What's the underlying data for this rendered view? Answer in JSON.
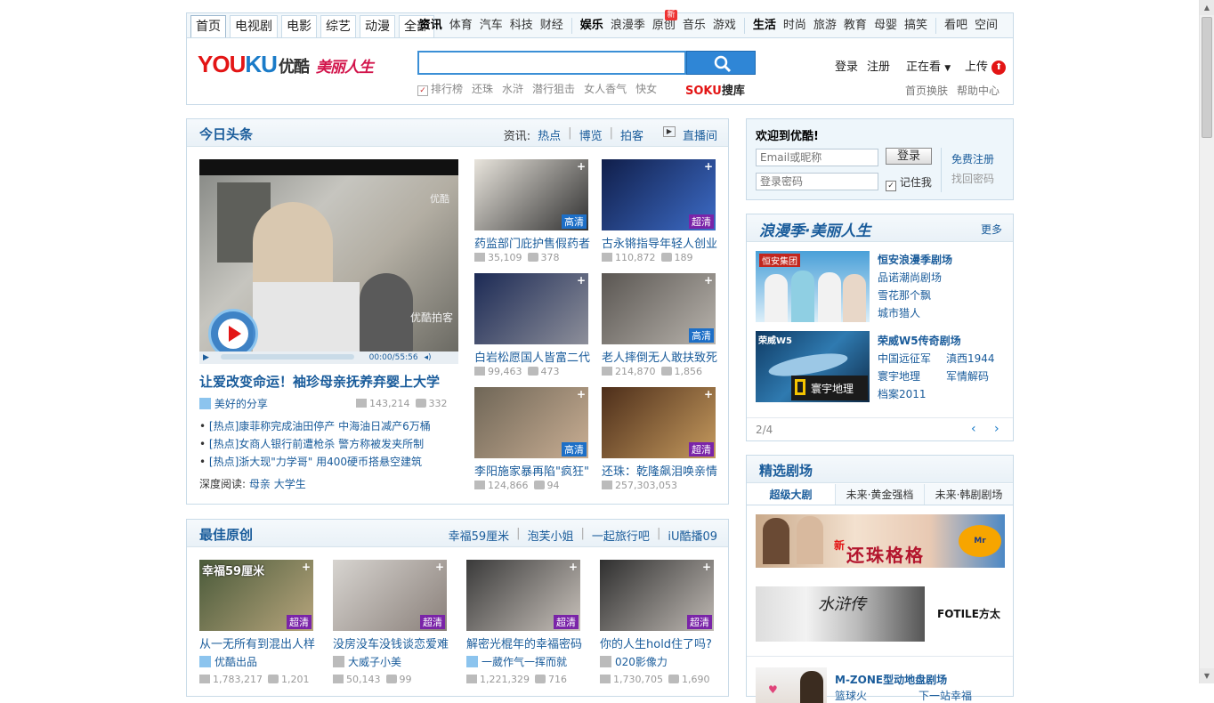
{
  "nav": {
    "tabs": [
      "首页",
      "电视剧",
      "电影",
      "综艺",
      "动漫",
      "全部"
    ],
    "groups": [
      {
        "head": "资讯",
        "items": [
          "体育",
          "汽车",
          "科技",
          "财经"
        ]
      },
      {
        "head": "娱乐",
        "items": [
          "浪漫季",
          "原创",
          "音乐",
          "游戏"
        ]
      },
      {
        "head": "生活",
        "items": [
          "时尚",
          "旅游",
          "教育",
          "母婴",
          "搞笑"
        ]
      },
      {
        "head": "",
        "items": [
          "看吧",
          "空间"
        ]
      }
    ],
    "new_badge": "新"
  },
  "header": {
    "logo_you": "YOU",
    "logo_ku": "KU",
    "logo_cn": "优酷",
    "slogan": "美丽人生",
    "hot_words": [
      "排行榜",
      "还珠",
      "水浒",
      "潜行狙击",
      "女人香气",
      "快女"
    ],
    "soku_s": "SOKU",
    "soku_b": "搜库",
    "login": "登录",
    "register": "注册",
    "watching": "正在看",
    "upload": "上传",
    "skin": "首页换肤",
    "help": "帮助中心"
  },
  "headlines": {
    "title": "今日头条",
    "links_label": "资讯:",
    "links": [
      "热点",
      "博览",
      "拍客"
    ],
    "live": "直播间",
    "main_title": "让爱改变命运！袖珍母亲抚养弃婴上大学",
    "main_user": "美好的分享",
    "main_plays": "143,214",
    "main_comments": "332",
    "player_time": "00:00/55:56",
    "watermark": "优酷",
    "watermark2": "优酷拍客",
    "news": [
      "[热点]康菲称完成油田停产 中海油日减产6万桶",
      "[热点]女商人银行前遭枪杀 警方称被发夹所制",
      "[热点]浙大现\"力学哥\" 用400硬币搭悬空建筑"
    ],
    "deep_label": "深度阅读:",
    "deep_links": "母亲 大学生",
    "videos": [
      {
        "title": "药监部门庇护售假药者",
        "plays": "35,109",
        "comments": "378",
        "q": "高清"
      },
      {
        "title": "古永锵指导年轻人创业",
        "plays": "110,872",
        "comments": "189",
        "q": "超清"
      },
      {
        "title": "白岩松愿国人皆富二代",
        "plays": "99,463",
        "comments": "473",
        "q": ""
      },
      {
        "title": "老人摔倒无人敢扶致死",
        "plays": "214,870",
        "comments": "1,856",
        "q": "高清"
      },
      {
        "title": "李阳施家暴再陷\"疯狂\"",
        "plays": "124,866",
        "comments": "94",
        "q": "高清"
      },
      {
        "title": "还珠：乾隆飙泪唤亲情",
        "plays": "257,303,053",
        "comments": "",
        "q": "超清"
      }
    ]
  },
  "original": {
    "title": "最佳原创",
    "links": [
      "幸福59厘米",
      "泡芙小姐",
      "一起旅行吧",
      "iU酷播09"
    ],
    "videos": [
      {
        "title": "从一无所有到混出人样",
        "user": "优酷出品",
        "plays": "1,783,217",
        "comments": "1,201",
        "q": "超清",
        "cap": "幸福59厘米"
      },
      {
        "title": "没房没车没钱谈恋爱难",
        "user": "大威子小美",
        "plays": "50,143",
        "comments": "99",
        "q": "超清",
        "cap": ""
      },
      {
        "title": "解密光棍年的幸福密码",
        "user": "一葳作气一挥而就",
        "plays": "1,221,329",
        "comments": "716",
        "q": "超清",
        "cap": ""
      },
      {
        "title": "你的人生hold住了吗?",
        "user": "020影像力",
        "plays": "1,730,705",
        "comments": "1,690",
        "q": "超清",
        "cap": ""
      }
    ]
  },
  "login": {
    "welcome": "欢迎到优酷!",
    "email_ph": "Email或昵称",
    "pwd_ph": "登录密码",
    "btn": "登录",
    "remember": "记住我",
    "free_reg": "免费注册",
    "find_pwd": "找回密码"
  },
  "romance": {
    "title": "浪漫季·美丽人生",
    "more": "更多",
    "block1": {
      "head": "恒安浪漫季剧场",
      "items": [
        "品诺潮尚剧场",
        "雪花那个飘",
        "城市猎人"
      ],
      "brand": "恒安集团"
    },
    "block2": {
      "head": "荣威W5传奇剧场",
      "items": [
        "中国远征军",
        "滇西1944",
        "寰宇地理",
        "军情解码",
        "档案2011"
      ],
      "brand": "荣威W5",
      "ng": "寰宇地理"
    },
    "pager": "2/4"
  },
  "drama": {
    "title": "精选剧场",
    "tabs": [
      "超级大剧",
      "未来·黄金强档",
      "未来·韩剧剧场"
    ],
    "banner1": "还珠格格",
    "banner1_tag": "新",
    "banner1_brand": "Mr Muscle",
    "banner2": "水浒传",
    "banner2_brand": "FOTILE方太",
    "mzone": "M-ZONE型动地盘剧场",
    "mzone_sub1": "篮球火",
    "mzone_sub2": "下一站幸福"
  },
  "colors": {
    "brand_red": "#e31515",
    "link_blue": "#1a5c9b",
    "accent": "#2f86d6"
  }
}
